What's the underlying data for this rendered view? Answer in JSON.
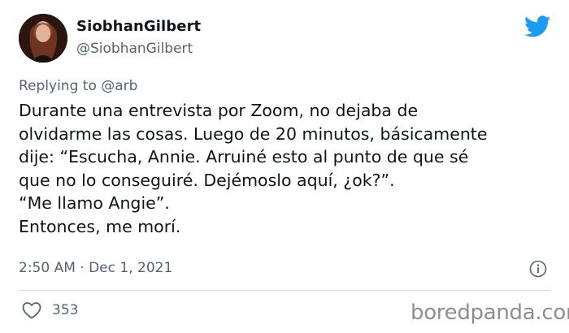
{
  "author": {
    "display_name": "SiobhanGilbert",
    "handle": "@SiobhanGilbert"
  },
  "reply": {
    "prefix": "Replying to ",
    "mention": "@arb"
  },
  "tweet": {
    "lines": [
      "Durante una entrevista por Zoom, no dejaba de",
      "olvidarme las cosas. Luego de 20 minutos, básicamente",
      "dije: “Escucha, Annie. Arruiné esto al punto de que sé",
      "que no lo conseguiré. Dejémoslo aquí, ¿ok?”.",
      "“Me llamo Angie”.",
      "Entonces, me morí."
    ]
  },
  "meta": {
    "timestamp": "2:50 AM · Dec 1, 2021"
  },
  "stats": {
    "likes": "353"
  },
  "watermark": {
    "text": "boredpanda.com"
  },
  "icons": {
    "brand": "twitter-bird-icon",
    "info": "info-icon",
    "like": "heart-icon"
  },
  "colors": {
    "twitter_blue": "#1d9bf0",
    "text_primary": "#0f1419",
    "text_secondary": "#536471",
    "divider": "#cfd9de",
    "watermark": "#8e8e8e"
  }
}
